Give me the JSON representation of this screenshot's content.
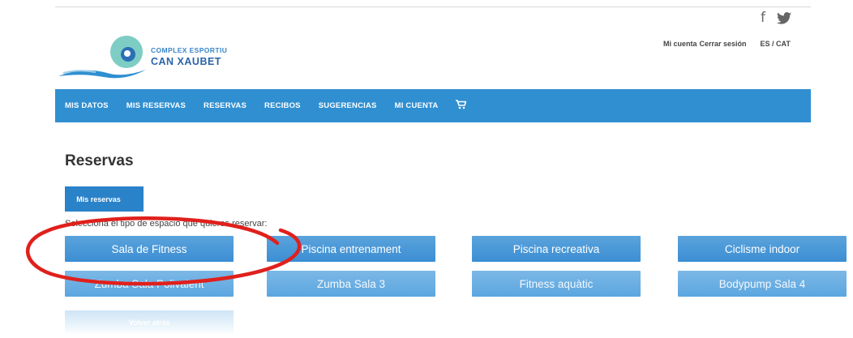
{
  "social": {
    "facebook": "f"
  },
  "logo": {
    "line1": "COMPLEX ESPORTIU",
    "line2": "CAN XAUBET"
  },
  "account": {
    "mi_cuenta": "Mi cuenta",
    "cerrar": "Cerrar sesión",
    "lang": "ES / CAT"
  },
  "nav": {
    "items": [
      "MIS DATOS",
      "MIS RESERVAS",
      "RESERVAS",
      "RECIBOS",
      "SUGERENCIAS",
      "MI CUENTA"
    ]
  },
  "page": {
    "title": "Reservas",
    "mis_reservas": "Mis reservas",
    "hint": "Selecciona el tipo de espacio que quieres reservar:",
    "back": "Volver atrás"
  },
  "options": {
    "row1": [
      "Sala de Fitness",
      "Piscina entrenament",
      "Piscina recreativa",
      "Ciclisme indoor"
    ],
    "row2": [
      "Zumba Sala Polivalent",
      "Zumba Sala 3",
      "Fitness aquàtic",
      "Bodypump Sala 4"
    ]
  },
  "colors": {
    "nav": "#2f8fd1",
    "button": "#3c8ed3",
    "annotation": "#e0201c"
  }
}
